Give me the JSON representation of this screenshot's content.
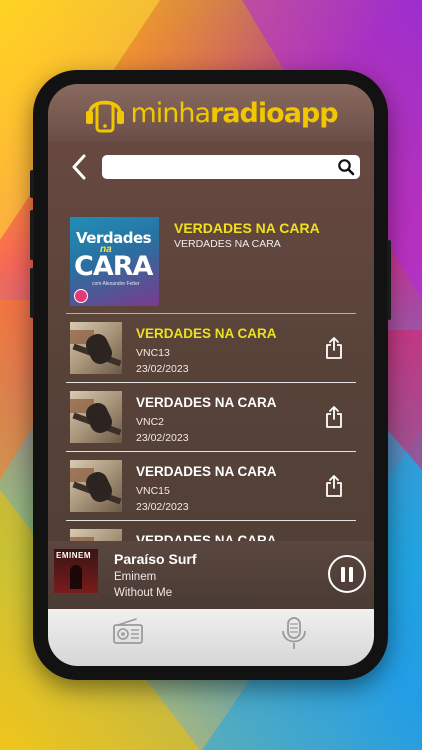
{
  "app": {
    "brand_part1": "minha",
    "brand_part2": "radio",
    "brand_part3": "app",
    "brand_color": "#f2c600"
  },
  "search": {
    "placeholder": "",
    "value": ""
  },
  "icons": {
    "back": "chevron-left-icon",
    "search": "magnifier-icon",
    "share": "share-icon",
    "pause": "pause-icon",
    "radio": "radio-icon",
    "podcast": "microphone-icon"
  },
  "program": {
    "title": "VERDADES NA CARA",
    "subtitle": "VERDADES NA CARA",
    "cover_text_1": "Verdades",
    "cover_text_2": "na",
    "cover_text_3": "CARA",
    "cover_text_4": "com Alexandre Fetter"
  },
  "episodes": [
    {
      "title": "VERDADES NA CARA",
      "code": "VNC13",
      "date": "23/02/2023",
      "highlighted": true
    },
    {
      "title": "VERDADES NA CARA",
      "code": "VNC2",
      "date": "23/02/2023",
      "highlighted": false
    },
    {
      "title": "VERDADES NA CARA",
      "code": "VNC15",
      "date": "23/02/2023",
      "highlighted": false
    },
    {
      "title": "VERDADES NA CARA",
      "code": "",
      "date": "",
      "highlighted": false
    }
  ],
  "player": {
    "title": "Paraíso Surf",
    "artist": "Eminem",
    "album": "Without Me",
    "cover_text": "EMINEM"
  },
  "colors": {
    "highlight": "#ece020",
    "screen_bg": "#574238"
  }
}
